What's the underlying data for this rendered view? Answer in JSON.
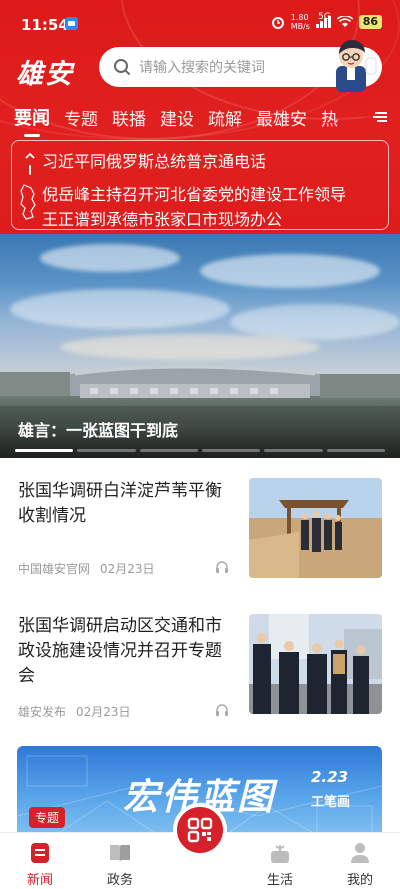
{
  "status": {
    "time": "11:54",
    "net_speed": "1.80",
    "net_unit": "MB/s",
    "net_type": "5G",
    "battery": "86"
  },
  "header": {
    "logo": "雄安"
  },
  "search": {
    "placeholder": "请输入搜索的关键词"
  },
  "tabs": [
    {
      "label": "要闻",
      "active": true
    },
    {
      "label": "专题"
    },
    {
      "label": "联播"
    },
    {
      "label": "建设"
    },
    {
      "label": "疏解"
    },
    {
      "label": "最雄安"
    },
    {
      "label": "热"
    }
  ],
  "headlines": [
    "习近平同俄罗斯总统普京通电话",
    "倪岳峰主持召开河北省委党的建设工作领导",
    "王正谱到承德市张家口市现场办公"
  ],
  "hero": {
    "caption": "雄言：一张蓝图干到底"
  },
  "articles": [
    {
      "title": "张国华调研白洋淀芦苇平衡收割情况",
      "source": "中国雄安官网",
      "date": "02月23日"
    },
    {
      "title": "张国华调研启动区交通和市政设施建设情况并召开专题会",
      "source": "雄安发布",
      "date": "02月23日"
    }
  ],
  "banner": {
    "text": "宏伟蓝图",
    "date": "2.23",
    "subtitle": "工笔画",
    "tag": "专题"
  },
  "bottom_nav": [
    {
      "label": "新闻",
      "active": true
    },
    {
      "label": "政务"
    },
    {
      "label": "生活"
    },
    {
      "label": "我的"
    }
  ],
  "colors": {
    "brand_red": "#dc1a1a",
    "active_red": "#d6202a"
  }
}
